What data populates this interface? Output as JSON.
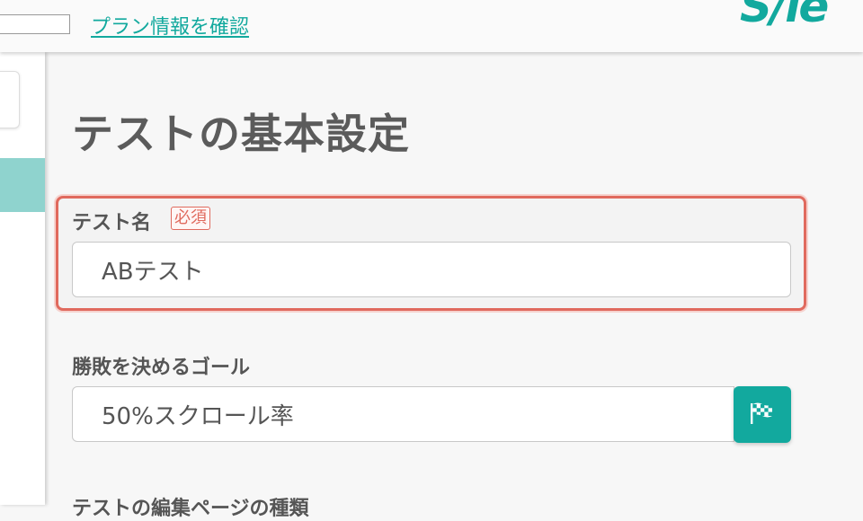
{
  "header": {
    "plan_link": "プラン情報を確認",
    "logo_text": "S/le",
    "accent_color": "#12a99e"
  },
  "main": {
    "title": "テストの基本設定",
    "test_name": {
      "label": "テスト名",
      "required_badge": "必須",
      "value": "ABテスト"
    },
    "goal": {
      "label": "勝敗を決めるゴール",
      "value": "50%スクロール率",
      "button_icon": "checkered-flag-icon"
    },
    "next_section_label": "テストの編集ページの種類"
  }
}
